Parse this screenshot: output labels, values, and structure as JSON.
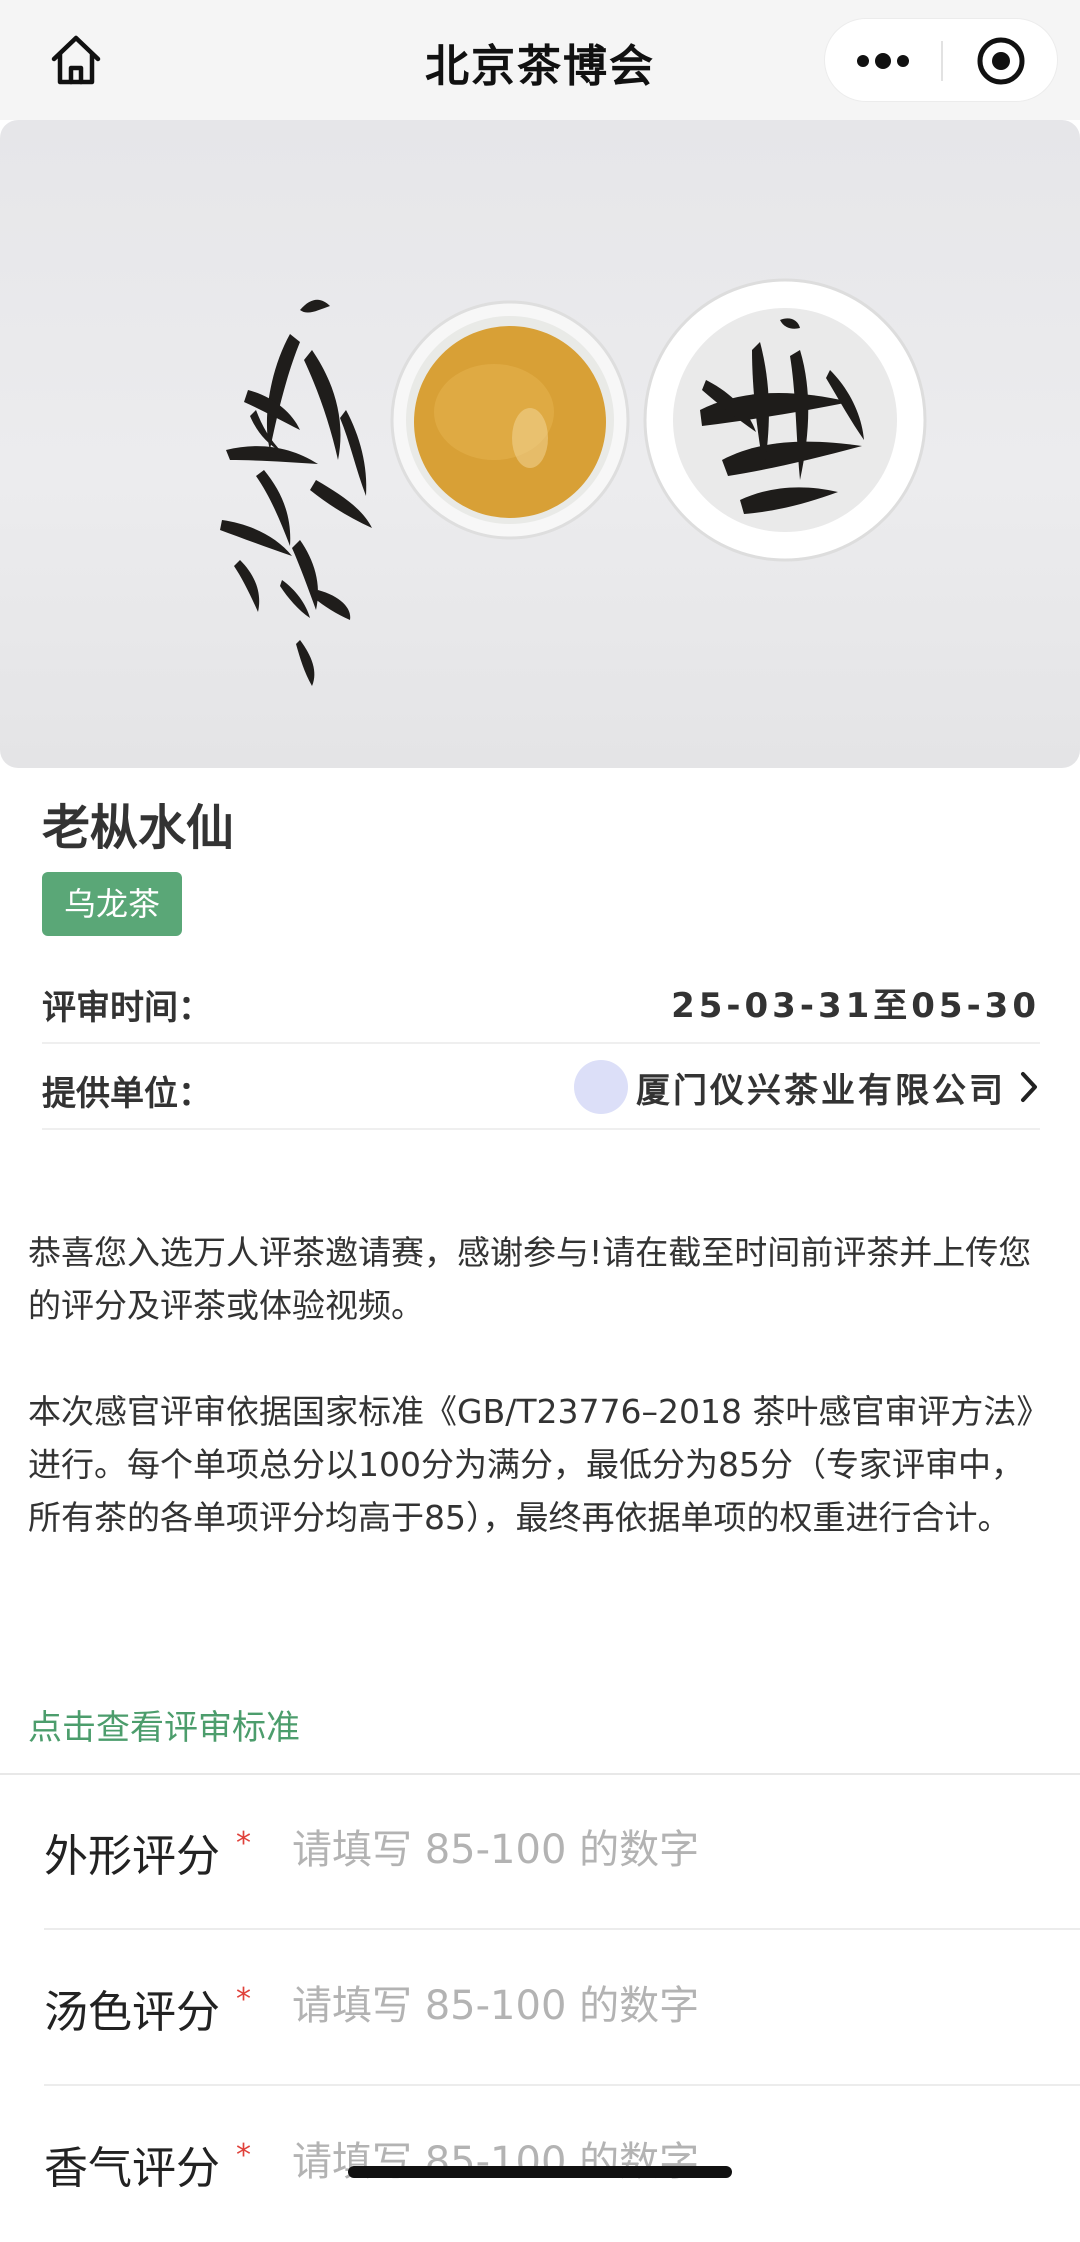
{
  "nav": {
    "title": "北京茶博会",
    "icons": {
      "home": "home-icon",
      "more": "more-dots-icon",
      "target": "target-icon"
    }
  },
  "hero": {
    "image": "tea-leaves-photo"
  },
  "product": {
    "name": "老枞水仙",
    "category": "乌龙茶",
    "category_color": "#5aa777",
    "review_time_label": "评审时间：",
    "review_time_value": "25-03-31至05-30",
    "supplier_label": "提供单位：",
    "supplier_name": "厦门仪兴茶业有限公司"
  },
  "description": {
    "p1": "恭喜您入选万人评茶邀请赛，感谢参与!请在截至时间前评茶并上传您的评分及评茶或体验视频。",
    "p2": "本次感官评审依据国家标准《GB/T23776–2018 茶叶感官审评方法》进行。每个单项总分以100分为满分，最低分为85分（专家评审中，所有茶的各单项评分均高于85），最终再依据单项的权重进行合计。"
  },
  "criteria_link": "点击查看评审标准",
  "form": {
    "required_mark": "*",
    "fields": [
      {
        "label": "外形评分",
        "placeholder": "请填写 85-100 的数字",
        "value": ""
      },
      {
        "label": "汤色评分",
        "placeholder": "请填写 85-100 的数字",
        "value": ""
      },
      {
        "label": "香气评分",
        "placeholder": "请填写 85-100 的数字",
        "value": ""
      }
    ]
  },
  "colors": {
    "accent_green": "#4c9d6c",
    "required_red": "#e0413a"
  }
}
